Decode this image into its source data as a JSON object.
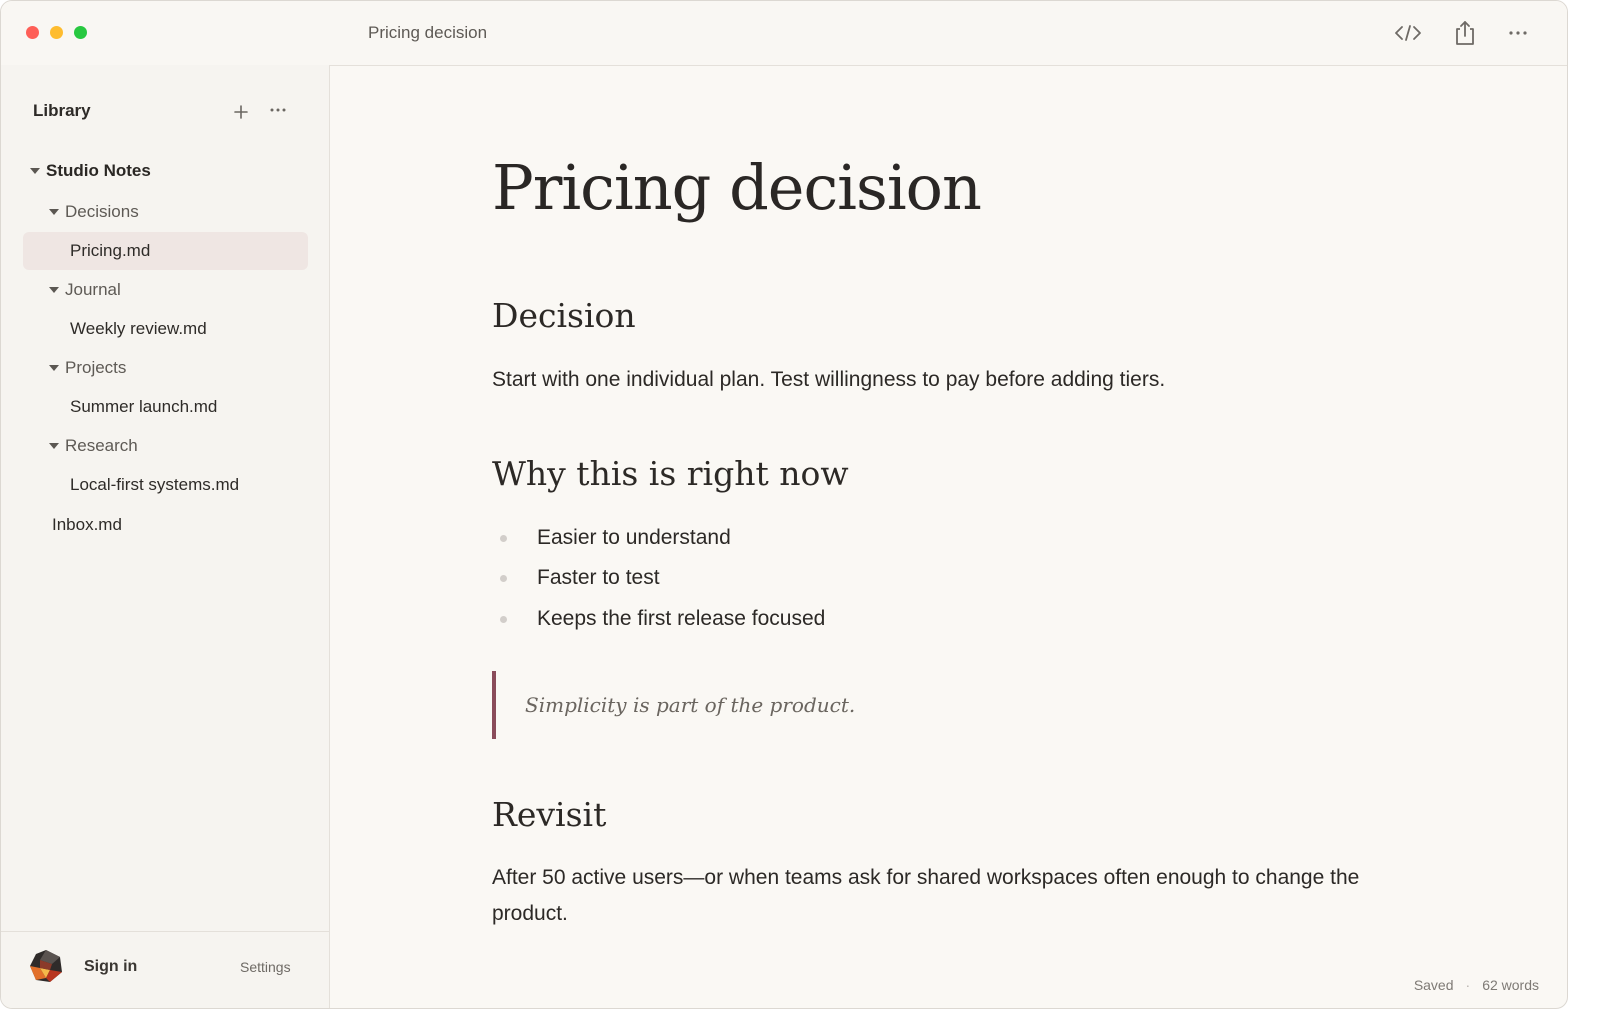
{
  "window": {
    "title": "Pricing decision"
  },
  "toolbar": {
    "icons": [
      "code-icon",
      "share-icon",
      "more-icon"
    ]
  },
  "sidebar": {
    "title": "Library",
    "root": {
      "label": "Studio Notes",
      "expanded": true
    },
    "folders": [
      {
        "label": "Decisions",
        "expanded": true,
        "files": [
          "Pricing.md"
        ]
      },
      {
        "label": "Journal",
        "expanded": true,
        "files": [
          "Weekly review.md"
        ]
      },
      {
        "label": "Projects",
        "expanded": true,
        "files": [
          "Summer launch.md"
        ]
      },
      {
        "label": "Research",
        "expanded": true,
        "files": [
          "Local-first systems.md"
        ]
      }
    ],
    "loose_files": [
      "Inbox.md"
    ],
    "selected_file": "Pricing.md",
    "footer": {
      "sign_in": "Sign in",
      "settings": "Settings"
    }
  },
  "document": {
    "title": "Pricing decision",
    "sections": [
      {
        "heading": "Decision",
        "body": "Start with one individual plan. Test willingness to pay before adding tiers."
      },
      {
        "heading": "Why this is right now",
        "bullets": [
          "Easier to understand",
          "Faster to test",
          "Keeps the first release focused"
        ],
        "quote": "Simplicity is part of the product."
      },
      {
        "heading": "Revisit",
        "body": "After 50 active users—or when teams ask for shared workspaces often enough to change the product."
      }
    ]
  },
  "status": {
    "save_state": "Saved",
    "separator": "·",
    "word_count": "62 words"
  },
  "colors": {
    "background": "#faf8f4",
    "sidebar": "#f6f4f0",
    "selection": "#efe6e3",
    "quote_bar": "#8a4c5a"
  }
}
